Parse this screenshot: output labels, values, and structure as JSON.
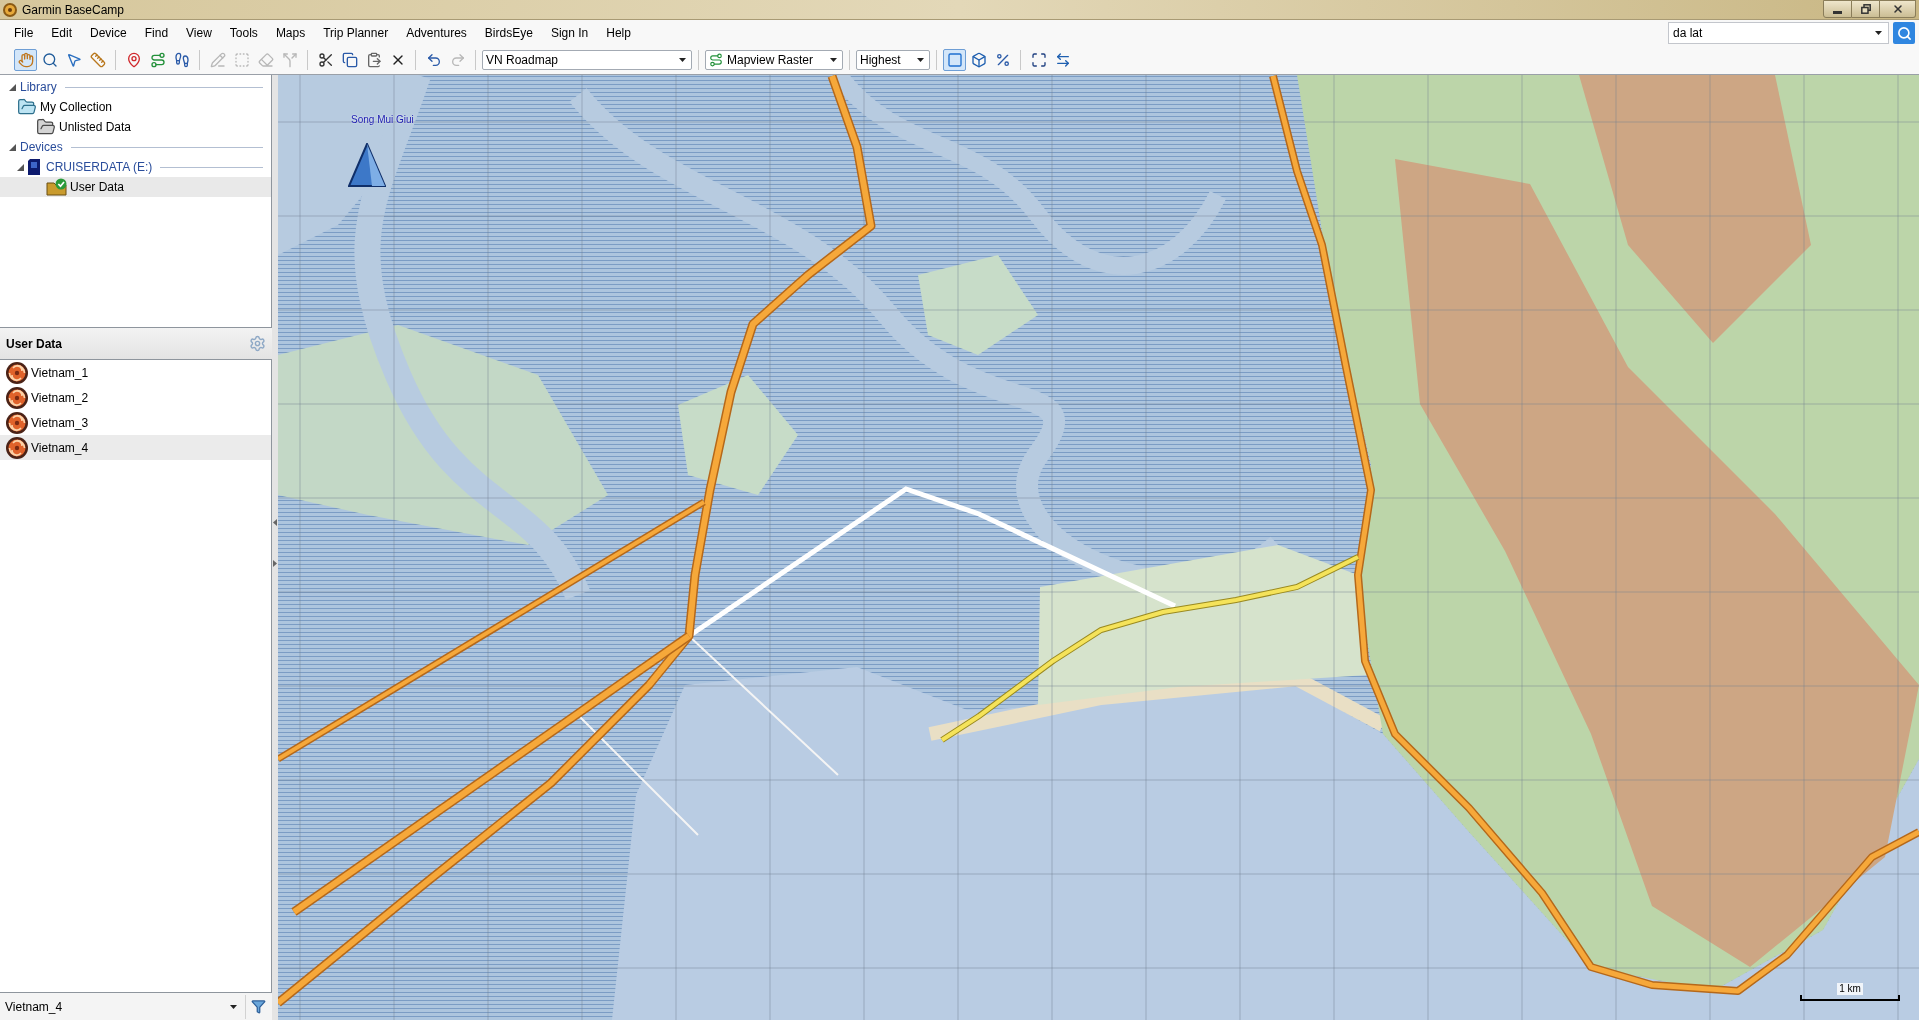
{
  "window": {
    "title": "Garmin BaseCamp"
  },
  "menu": [
    "File",
    "Edit",
    "Device",
    "Find",
    "View",
    "Tools",
    "Maps",
    "Trip Planner",
    "Adventures",
    "BirdsEye",
    "Sign In",
    "Help"
  ],
  "search": {
    "value": "da lat"
  },
  "toolbar": [
    {
      "kind": "tools",
      "items": [
        {
          "kind": "hand",
          "selected": true,
          "disabled": false
        },
        {
          "kind": "magnifier",
          "selected": false,
          "disabled": false
        },
        {
          "kind": "pointer",
          "selected": false,
          "disabled": false
        },
        {
          "kind": "ruler",
          "selected": false,
          "disabled": false
        }
      ]
    },
    {
      "kind": "tools",
      "items": [
        {
          "kind": "waypoint",
          "selected": false,
          "disabled": false
        },
        {
          "kind": "route",
          "selected": false,
          "disabled": false
        },
        {
          "kind": "track",
          "selected": false,
          "disabled": false
        }
      ]
    },
    {
      "kind": "tools",
      "items": [
        {
          "kind": "insert",
          "selected": false,
          "disabled": true
        },
        {
          "kind": "select_area",
          "selected": false,
          "disabled": true
        },
        {
          "kind": "eraser",
          "selected": false,
          "disabled": true
        },
        {
          "kind": "divide",
          "selected": false,
          "disabled": true
        }
      ]
    },
    {
      "kind": "tools",
      "items": [
        {
          "kind": "cut",
          "selected": false,
          "disabled": false
        },
        {
          "kind": "copy",
          "selected": false,
          "disabled": false
        },
        {
          "kind": "paste",
          "selected": false,
          "disabled": false
        },
        {
          "kind": "delete",
          "selected": false,
          "disabled": false
        }
      ]
    },
    {
      "kind": "tools",
      "items": [
        {
          "kind": "undo",
          "selected": false,
          "disabled": false
        },
        {
          "kind": "redo",
          "selected": false,
          "disabled": true
        }
      ]
    },
    {
      "kind": "combo",
      "value": "VN Roadmap"
    },
    {
      "kind": "icon_combo",
      "value": "Mapview Raster"
    },
    {
      "kind": "combo",
      "value": "Highest"
    },
    {
      "kind": "tools",
      "items": [
        {
          "kind": "view_2d",
          "selected": true,
          "disabled": false
        },
        {
          "kind": "view_3d",
          "selected": false,
          "disabled": false
        },
        {
          "kind": "layers",
          "selected": false,
          "disabled": false
        }
      ]
    },
    {
      "kind": "tools",
      "items": [
        {
          "kind": "fit",
          "selected": false,
          "disabled": false
        },
        {
          "kind": "swap",
          "selected": false,
          "disabled": false
        }
      ]
    }
  ],
  "library_tree": [
    {
      "kind": "section",
      "label": "Library",
      "expanded": true,
      "selected": false,
      "children": [
        {
          "kind": "collection",
          "label": "My Collection",
          "selected": false,
          "children": [
            {
              "kind": "folder",
              "label": "Unlisted Data",
              "selected": false
            }
          ]
        }
      ]
    },
    {
      "kind": "section",
      "label": "Devices",
      "expanded": true,
      "selected": false,
      "children": [
        {
          "kind": "device",
          "label": "CRUISERDATA (E:)",
          "expanded": true,
          "selected": false,
          "children": [
            {
              "kind": "device_data",
              "label": "User Data",
              "selected": true
            }
          ]
        }
      ]
    }
  ],
  "user_data": {
    "title": "User Data",
    "items": [
      {
        "label": "Vietnam_1",
        "selected": false
      },
      {
        "label": "Vietnam_2",
        "selected": false
      },
      {
        "label": "Vietnam_3",
        "selected": false
      },
      {
        "label": "Vietnam_4",
        "selected": true
      }
    ]
  },
  "filter": {
    "value": "Vietnam_4"
  },
  "map": {
    "waypoints": [
      {
        "label": "Song Mui Giui"
      }
    ],
    "scale": "1 km"
  }
}
